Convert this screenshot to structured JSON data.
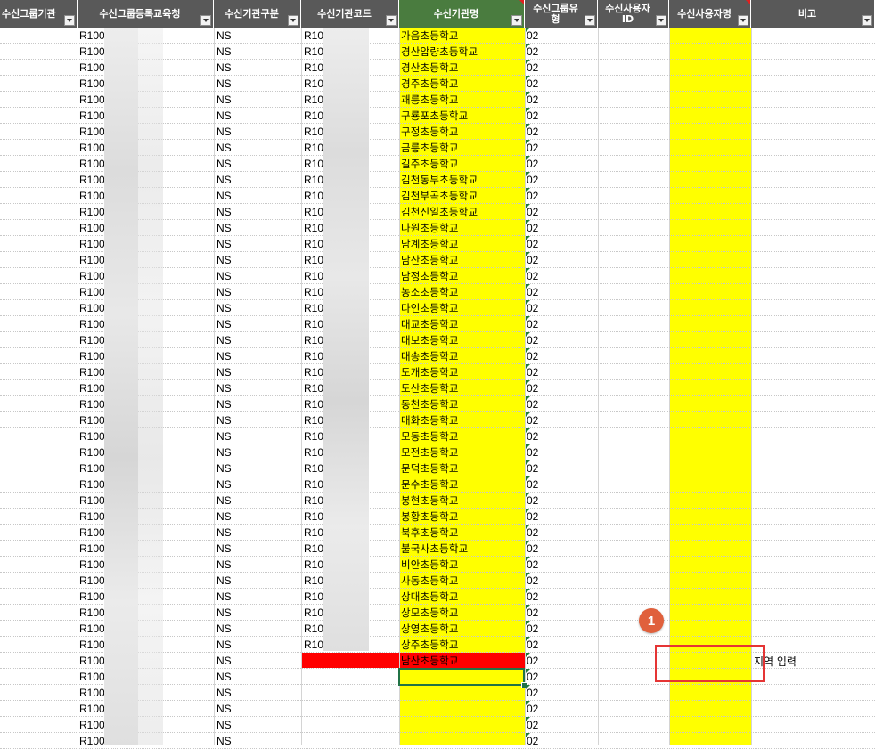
{
  "headers": [
    {
      "id": "group-order",
      "label": "수신그룹기관"
    },
    {
      "id": "group-office",
      "label": "수신그룹등록교육청"
    },
    {
      "id": "org-type",
      "label": "수신기관구분"
    },
    {
      "id": "org-code",
      "label": "수신기관코드"
    },
    {
      "id": "org-name",
      "label": "수신기관명"
    },
    {
      "id": "group-kind",
      "label": "수신그룹유\n형"
    },
    {
      "id": "user-id",
      "label": "수신사용자\nID"
    },
    {
      "id": "user-name",
      "label": "수신사용자명"
    },
    {
      "id": "remarks",
      "label": "비고"
    }
  ],
  "rows": [
    {
      "code": "R100",
      "type": "NS",
      "org": "R10",
      "name": "가음초등학교",
      "kind": "02"
    },
    {
      "code": "R100",
      "type": "NS",
      "org": "R10",
      "name": "경산압량초등학교",
      "kind": "02"
    },
    {
      "code": "R100",
      "type": "NS",
      "org": "R10",
      "name": "경산초등학교",
      "kind": "02"
    },
    {
      "code": "R100",
      "type": "NS",
      "org": "R10",
      "name": "경주초등학교",
      "kind": "02"
    },
    {
      "code": "R100",
      "type": "NS",
      "org": "R10",
      "name": "괘릉초등학교",
      "kind": "02"
    },
    {
      "code": "R100",
      "type": "NS",
      "org": "R10",
      "name": "구룡포초등학교",
      "kind": "02"
    },
    {
      "code": "R100",
      "type": "NS",
      "org": "R10",
      "name": "구정초등학교",
      "kind": "02"
    },
    {
      "code": "R100",
      "type": "NS",
      "org": "R10",
      "name": "금릉초등학교",
      "kind": "02"
    },
    {
      "code": "R100",
      "type": "NS",
      "org": "R10",
      "name": "길주초등학교",
      "kind": "02"
    },
    {
      "code": "R100",
      "type": "NS",
      "org": "R10",
      "name": "김천동부초등학교",
      "kind": "02"
    },
    {
      "code": "R100",
      "type": "NS",
      "org": "R10",
      "name": "김천부곡초등학교",
      "kind": "02"
    },
    {
      "code": "R100",
      "type": "NS",
      "org": "R10",
      "name": "김천신일초등학교",
      "kind": "02"
    },
    {
      "code": "R100",
      "type": "NS",
      "org": "R10",
      "name": "나원초등학교",
      "kind": "02"
    },
    {
      "code": "R100",
      "type": "NS",
      "org": "R10",
      "name": "남계초등학교",
      "kind": "02"
    },
    {
      "code": "R100",
      "type": "NS",
      "org": "R10",
      "name": "남산초등학교",
      "kind": "02"
    },
    {
      "code": "R100",
      "type": "NS",
      "org": "R10",
      "name": "남정초등학교",
      "kind": "02"
    },
    {
      "code": "R100",
      "type": "NS",
      "org": "R10",
      "name": "농소초등학교",
      "kind": "02"
    },
    {
      "code": "R100",
      "type": "NS",
      "org": "R10",
      "name": "다인초등학교",
      "kind": "02"
    },
    {
      "code": "R100",
      "type": "NS",
      "org": "R10",
      "name": "대교초등학교",
      "kind": "02"
    },
    {
      "code": "R100",
      "type": "NS",
      "org": "R10",
      "name": "대보초등학교",
      "kind": "02"
    },
    {
      "code": "R100",
      "type": "NS",
      "org": "R10",
      "name": "대송초등학교",
      "kind": "02"
    },
    {
      "code": "R100",
      "type": "NS",
      "org": "R10",
      "name": "도개초등학교",
      "kind": "02"
    },
    {
      "code": "R100",
      "type": "NS",
      "org": "R10",
      "name": "도산초등학교",
      "kind": "02"
    },
    {
      "code": "R100",
      "type": "NS",
      "org": "R10",
      "name": "동천초등학교",
      "kind": "02"
    },
    {
      "code": "R100",
      "type": "NS",
      "org": "R10",
      "name": "매화초등학교",
      "kind": "02"
    },
    {
      "code": "R100",
      "type": "NS",
      "org": "R10",
      "name": "모동초등학교",
      "kind": "02"
    },
    {
      "code": "R100",
      "type": "NS",
      "org": "R10",
      "name": "모전초등학교",
      "kind": "02"
    },
    {
      "code": "R100",
      "type": "NS",
      "org": "R10",
      "name": "문덕초등학교",
      "kind": "02"
    },
    {
      "code": "R100",
      "type": "NS",
      "org": "R10",
      "name": "문수초등학교",
      "kind": "02"
    },
    {
      "code": "R100",
      "type": "NS",
      "org": "R10",
      "name": "봉현초등학교",
      "kind": "02"
    },
    {
      "code": "R100",
      "type": "NS",
      "org": "R10",
      "name": "봉황초등학교",
      "kind": "02"
    },
    {
      "code": "R100",
      "type": "NS",
      "org": "R10",
      "name": "북후초등학교",
      "kind": "02"
    },
    {
      "code": "R100",
      "type": "NS",
      "org": "R10",
      "name": "불국사초등학교",
      "kind": "02"
    },
    {
      "code": "R100",
      "type": "NS",
      "org": "R10",
      "name": "비안초등학교",
      "kind": "02"
    },
    {
      "code": "R100",
      "type": "NS",
      "org": "R10",
      "name": "사동초등학교",
      "kind": "02"
    },
    {
      "code": "R100",
      "type": "NS",
      "org": "R10",
      "name": "상대초등학교",
      "kind": "02"
    },
    {
      "code": "R100",
      "type": "NS",
      "org": "R10",
      "name": "상모초등학교",
      "kind": "02"
    },
    {
      "code": "R100",
      "type": "NS",
      "org": "R10",
      "name": "상영초등학교",
      "kind": "02"
    },
    {
      "code": "R100",
      "type": "NS",
      "org": "R10",
      "name": "상주초등학교",
      "kind": "02"
    },
    {
      "code": "R100",
      "type": "NS",
      "org": "",
      "name": "남산초등학교",
      "kind": "02"
    },
    {
      "code": "R100",
      "type": "NS",
      "org": "",
      "name": "",
      "kind": "02"
    },
    {
      "code": "R100",
      "type": "NS",
      "org": "",
      "name": "",
      "kind": "02"
    },
    {
      "code": "R100",
      "type": "NS",
      "org": "",
      "name": "",
      "kind": "02"
    },
    {
      "code": "R100",
      "type": "NS",
      "org": "",
      "name": "",
      "kind": "02"
    },
    {
      "code": "R100",
      "type": "NS",
      "org": "",
      "name": "",
      "kind": "02"
    }
  ],
  "annotation": {
    "badge": "1",
    "note": "지역 입력"
  },
  "colors": {
    "header": "#595959",
    "header_active": "#4a7c3f",
    "highlight": "#ffff00",
    "error_cell": "#ff0000",
    "annotation": "#e53535",
    "badge": "#e0603c"
  }
}
